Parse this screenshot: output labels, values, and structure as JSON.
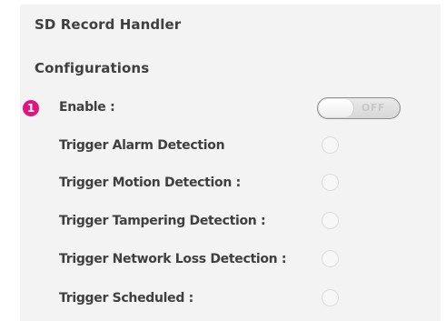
{
  "header": {
    "title": "SD Record Handler",
    "section": "Configurations"
  },
  "enable": {
    "badge": "1",
    "label": "Enable :",
    "toggle_state": "OFF"
  },
  "triggers": [
    {
      "label": "Trigger Alarm Detection"
    },
    {
      "label": "Trigger Motion Detection :"
    },
    {
      "label": "Trigger Tampering Detection :"
    },
    {
      "label": "Trigger Network Loss Detection :"
    },
    {
      "label": "Trigger Scheduled :"
    }
  ],
  "colors": {
    "badge": "#e0157f",
    "panel": "#f3f3f3"
  }
}
